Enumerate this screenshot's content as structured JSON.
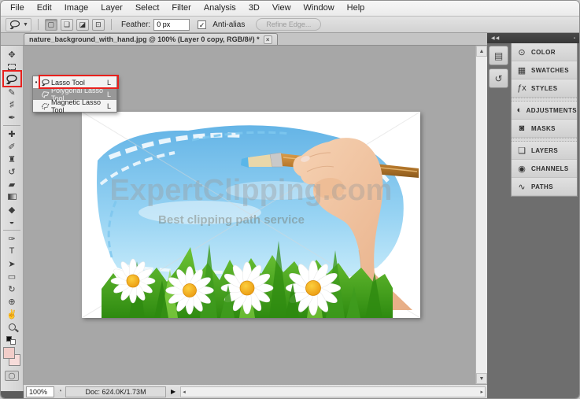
{
  "menu": {
    "items": [
      "File",
      "Edit",
      "Image",
      "Layer",
      "Select",
      "Filter",
      "Analysis",
      "3D",
      "View",
      "Window",
      "Help"
    ]
  },
  "options": {
    "mode_new": "▢",
    "mode_add": "❏",
    "mode_subtract": "◪",
    "mode_intersect": "⊡",
    "feather_label": "Feather:",
    "feather_value": "0 px",
    "antialias_check": "✓",
    "antialias_label": "Anti-alias",
    "refine_edge_label": "Refine Edge..."
  },
  "tab": {
    "title": "nature_background_with_hand.jpg @ 100% (Layer 0 copy, RGB/8#) *",
    "close": "×"
  },
  "toolbar": {
    "tools": [
      {
        "name": "move-tool",
        "glyph": "✥"
      },
      {
        "name": "marquee-tool",
        "glyph": ""
      },
      {
        "name": "lasso-tool",
        "glyph": ""
      },
      {
        "name": "quick-selection-tool",
        "glyph": "✎"
      },
      {
        "name": "crop-tool",
        "glyph": "♯"
      },
      {
        "name": "eyedropper-tool",
        "glyph": "✒"
      },
      {
        "name": "healing-brush-tool",
        "glyph": "✚"
      },
      {
        "name": "brush-tool",
        "glyph": "✐"
      },
      {
        "name": "clone-stamp-tool",
        "glyph": "♜"
      },
      {
        "name": "history-brush-tool",
        "glyph": "↺"
      },
      {
        "name": "eraser-tool",
        "glyph": "▰"
      },
      {
        "name": "gradient-tool",
        "glyph": ""
      },
      {
        "name": "blur-tool",
        "glyph": "◆"
      },
      {
        "name": "dodge-tool",
        "glyph": "◒"
      },
      {
        "name": "pen-tool",
        "glyph": "✑"
      },
      {
        "name": "type-tool",
        "glyph": "T"
      },
      {
        "name": "path-selection-tool",
        "glyph": "➤"
      },
      {
        "name": "shape-tool",
        "glyph": "▭"
      },
      {
        "name": "3d-rotate-tool",
        "glyph": "↻"
      },
      {
        "name": "3d-orbit-tool",
        "glyph": "⊕"
      },
      {
        "name": "hand-tool",
        "glyph": "✌"
      },
      {
        "name": "zoom-tool",
        "glyph": ""
      }
    ]
  },
  "flyout": {
    "items": [
      {
        "bullet": "•",
        "label": "Lasso Tool",
        "shortcut": "L"
      },
      {
        "bullet": "",
        "label": "Polygonal Lasso Tool",
        "shortcut": "L"
      },
      {
        "bullet": "",
        "label": "Magnetic Lasso Tool",
        "shortcut": "L"
      }
    ]
  },
  "dock": {
    "collapse_icon": "◀◀",
    "menu_dot": "▪",
    "collapsed_icons": [
      {
        "name": "mini-bridge-panel-icon",
        "glyph": "▤"
      },
      {
        "name": "history-panel-icon",
        "glyph": "↺"
      }
    ],
    "panels": {
      "groups": [
        [
          {
            "icon": "⊙",
            "label": "COLOR"
          },
          {
            "icon": "▦",
            "label": "SWATCHES"
          },
          {
            "icon": "ƒx",
            "label": "STYLES"
          }
        ],
        [
          {
            "icon": "◐",
            "label": "ADJUSTMENTS"
          },
          {
            "icon": "◙",
            "label": "MASKS"
          }
        ],
        [
          {
            "icon": "❏",
            "label": "LAYERS"
          },
          {
            "icon": "◉",
            "label": "CHANNELS"
          },
          {
            "icon": "∿",
            "label": "PATHS"
          }
        ]
      ]
    }
  },
  "statusbar": {
    "zoom_value": "100%",
    "status_icon": "◔",
    "doc_label": "Doc: 624.0K/1.73M",
    "popup_arrow": "▶"
  },
  "scrollbars": {
    "up": "▲",
    "down": "▼",
    "left": "◂",
    "right": "▸"
  },
  "watermark": {
    "line1": "ExpertClipping.com",
    "line2": "Best clipping path service"
  },
  "colors": {
    "accent_red": "#E8201D",
    "canvas_bg": "#A7A7A7",
    "dock_bg": "#6E6E6E",
    "sky_blue": "#6DB8E8",
    "grass_green": "#3F9B1E",
    "daisy_center": "#F5A81C"
  }
}
